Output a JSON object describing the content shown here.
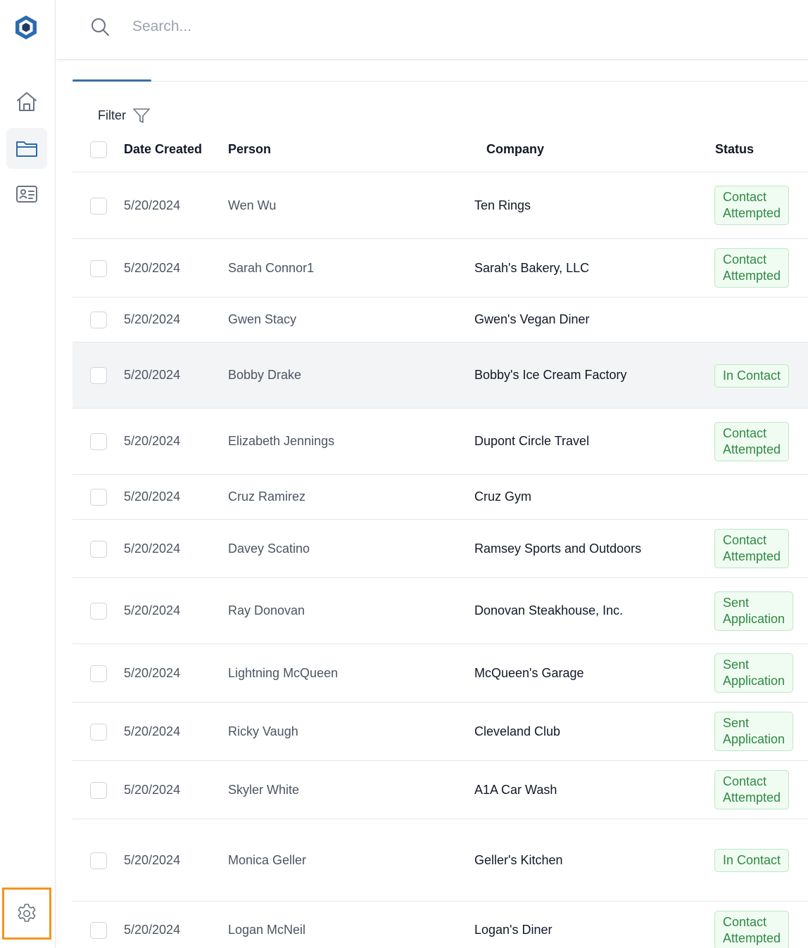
{
  "search": {
    "placeholder": "Search..."
  },
  "sidebar": {
    "items": [
      {
        "icon": "home-icon"
      },
      {
        "icon": "folder-icon",
        "active": true
      },
      {
        "icon": "contact-card-icon"
      }
    ],
    "settings_icon": "gear-icon"
  },
  "colors": {
    "accent": "#3b6ea5",
    "badge_text": "#2f8a43",
    "badge_bg": "#f0fbf2",
    "highlight": "#f5941e"
  },
  "filter": {
    "label": "Filter"
  },
  "table": {
    "columns": [
      "Date Created",
      "Person",
      "Company",
      "Status"
    ],
    "rows": [
      {
        "date": "5/20/2024",
        "person": "Wen Wu",
        "company": "Ten Rings",
        "status_line1": "Contact",
        "status_line2": "Attempted"
      },
      {
        "date": "5/20/2024",
        "person": "Sarah Connor1",
        "company": "Sarah's Bakery, LLC",
        "status_line1": "Contact",
        "status_line2": "Attempted"
      },
      {
        "date": "5/20/2024",
        "person": "Gwen Stacy",
        "company": "Gwen's Vegan Diner",
        "status_line1": "",
        "status_line2": ""
      },
      {
        "date": "5/20/2024",
        "person": "Bobby Drake",
        "company": "Bobby's Ice Cream Factory",
        "status_line1": "In Contact",
        "status_line2": ""
      },
      {
        "date": "5/20/2024",
        "person": "Elizabeth Jennings",
        "company": "Dupont Circle Travel",
        "status_line1": "Contact",
        "status_line2": "Attempted"
      },
      {
        "date": "5/20/2024",
        "person": "Cruz Ramirez",
        "company": "Cruz Gym",
        "status_line1": "",
        "status_line2": ""
      },
      {
        "date": "5/20/2024",
        "person": "Davey Scatino",
        "company": "Ramsey Sports and Outdoors",
        "status_line1": "Contact",
        "status_line2": "Attempted"
      },
      {
        "date": "5/20/2024",
        "person": "Ray Donovan",
        "company": "Donovan Steakhouse, Inc.",
        "status_line1": "Sent",
        "status_line2": "Application"
      },
      {
        "date": "5/20/2024",
        "person": "Lightning McQueen",
        "company": "McQueen's Garage",
        "status_line1": "Sent",
        "status_line2": "Application"
      },
      {
        "date": "5/20/2024",
        "person": "Ricky Vaugh",
        "company": "Cleveland Club",
        "status_line1": "Sent",
        "status_line2": "Application"
      },
      {
        "date": "5/20/2024",
        "person": "Skyler White",
        "company": "A1A Car Wash",
        "status_line1": "Contact",
        "status_line2": "Attempted"
      },
      {
        "date": "5/20/2024",
        "person": "Monica Geller",
        "company": "Geller's Kitchen",
        "status_line1": "In Contact",
        "status_line2": ""
      },
      {
        "date": "5/20/2024",
        "person": "Logan McNeil",
        "company": "Logan's Diner",
        "status_line1": "Contact",
        "status_line2": "Attempted"
      }
    ]
  }
}
